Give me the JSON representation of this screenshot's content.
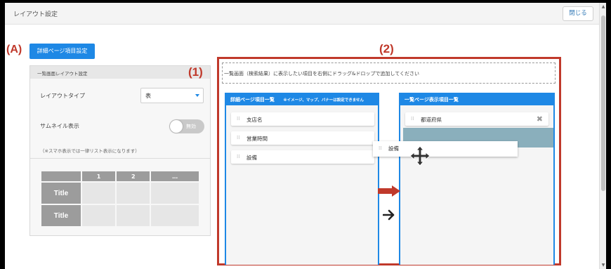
{
  "window": {
    "title": "レイアウト設定",
    "close_label": "閉じる"
  },
  "annotations": {
    "a": "(A)",
    "one": "(1)",
    "two": "(2)"
  },
  "detail_button_label": "詳細ページ項目設定",
  "left_panel": {
    "header": "一覧画面レイアウト設定",
    "layout_type_label": "レイアウトタイプ",
    "layout_type_value": "表",
    "thumbnail_label": "サムネイル表示",
    "thumbnail_toggle_text": "無効",
    "note": "（※スマホ表示では一律リスト表示になります）",
    "preview": {
      "headers": [
        "",
        "1",
        "2",
        "…"
      ],
      "row_labels": [
        "Title",
        "Title"
      ]
    }
  },
  "instruction": "一覧画面（検索結果）に表示したい項目を右側にドラッグ&ドロップで追加してください",
  "detail_column": {
    "title": "詳細ページ項目一覧",
    "note": "※イメージ、マップ、バナーは設定できません",
    "items": [
      "支店名",
      "営業時間",
      "設備"
    ]
  },
  "list_column": {
    "title": "一覧ページ表示項目一覧",
    "items": [
      "都道府県"
    ]
  },
  "dragging_item": "設備",
  "icons": {
    "grip": "grip-icon",
    "remove": "close-icon",
    "move": "move-icon",
    "arrow": "arrow-right-icon"
  },
  "colors": {
    "accent": "#1e88e5",
    "annotation": "#c0392b",
    "drop_zone": "#8aafbc"
  }
}
